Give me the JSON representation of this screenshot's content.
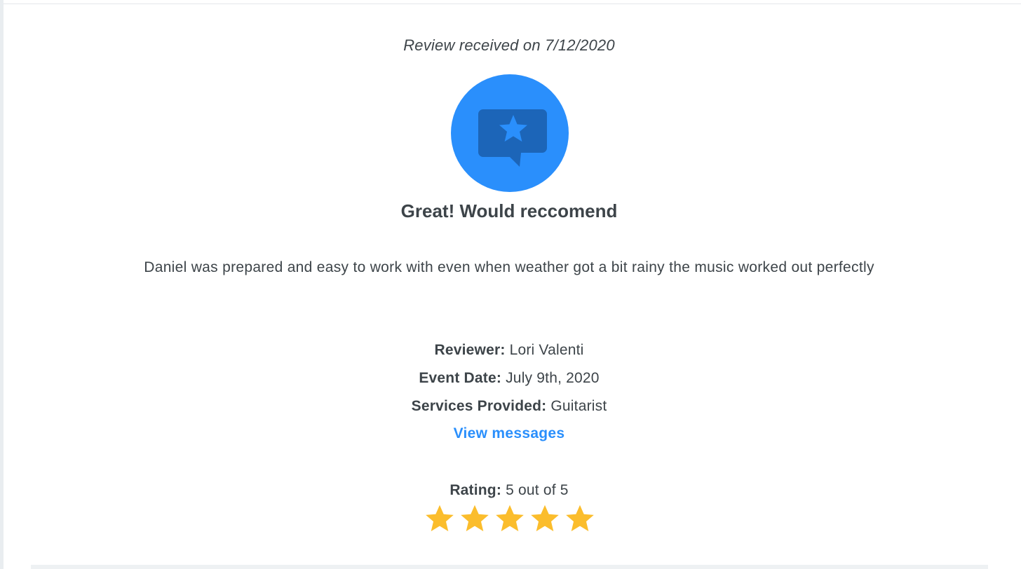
{
  "review": {
    "received_text": "Review received on 7/12/2020",
    "badge_icon": "review-star-speech-bubble-icon",
    "headline": "Great! Would reccomend",
    "body": "Daniel was prepared and easy to work with even when weather got a bit rainy the music worked out perfectly",
    "reviewer_label": "Reviewer:",
    "reviewer_value": "Lori Valenti",
    "event_date_label": "Event Date:",
    "event_date_value": "July 9th, 2020",
    "services_label": "Services Provided:",
    "services_value": "Guitarist",
    "view_messages_label": "View messages",
    "rating_label": "Rating:",
    "rating_value": "5 out of 5",
    "rating_stars_filled": 5,
    "rating_stars_total": 5
  },
  "colors": {
    "accent": "#2a8ffc",
    "badge_bubble": "#1c65b8",
    "star": "#fbbd2c",
    "text": "#3d4449"
  }
}
